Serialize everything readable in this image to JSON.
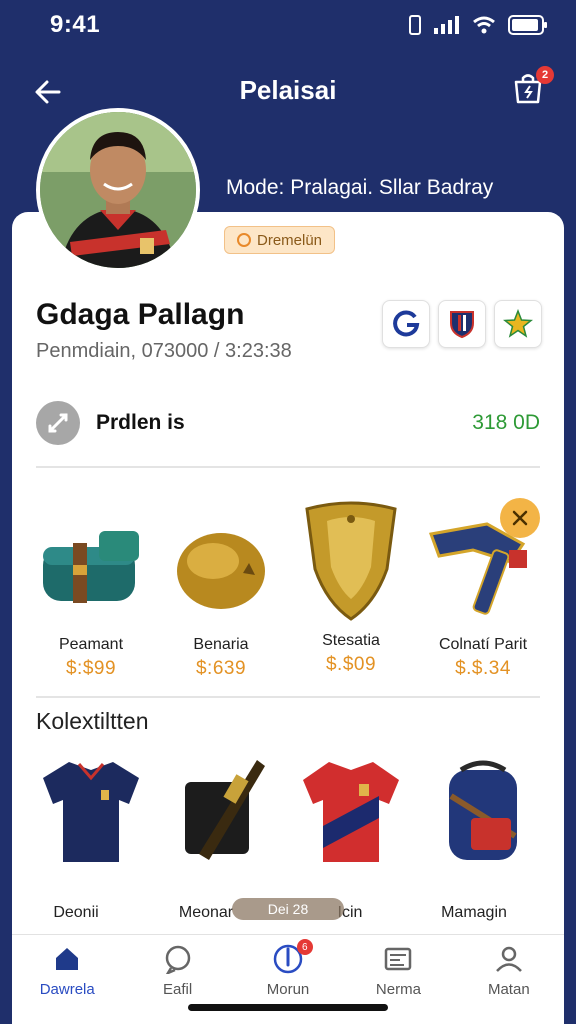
{
  "status": {
    "time": "9:41"
  },
  "header": {
    "title": "Pelaisai",
    "notification_count": "2"
  },
  "profile": {
    "subtitle": "Mode: Pralagai. Sllar Badray",
    "badge": "Dremelün",
    "name": "Gdaga Pallagn",
    "meta": "Penmdiain, 073000 / 3:23:38"
  },
  "action_icons": [
    "g-logo-icon",
    "club-crest-icon",
    "star-icon"
  ],
  "points": {
    "label": "Prdlen is",
    "value": "318 0D"
  },
  "shop_items": [
    {
      "name": "Peamant",
      "price": "$:$99",
      "icon": "bedroll-icon"
    },
    {
      "name": "Benaria",
      "price": "$:639",
      "icon": "helmet-icon"
    },
    {
      "name": "Stesatia",
      "price": "$.$09",
      "icon": "shield-icon"
    },
    {
      "name": "Colnatí Parit",
      "price": "$.$.34",
      "icon": "hammer-icon"
    }
  ],
  "collection": {
    "title": "Kolextiltten",
    "items": [
      {
        "name": "Deonii",
        "icon": "navy-jersey-icon"
      },
      {
        "name": "Meonar",
        "icon": "shoulder-bag-icon"
      },
      {
        "name": "Icin",
        "icon": "red-jersey-icon"
      },
      {
        "name": "Mamagin",
        "icon": "backpack-icon"
      }
    ]
  },
  "toast": "Dei 28",
  "nav": [
    {
      "label": "Dawrela",
      "icon": "home-icon"
    },
    {
      "label": "Eafil",
      "icon": "chat-icon"
    },
    {
      "label": "Morun",
      "icon": "compass-icon",
      "badge": "6"
    },
    {
      "label": "Nerma",
      "icon": "list-icon"
    },
    {
      "label": "Matan",
      "icon": "profile-icon"
    }
  ],
  "colors": {
    "bg": "#1f2f6b",
    "accent": "#2a4cc2",
    "price": "#e39224",
    "points": "#2e9a36"
  }
}
